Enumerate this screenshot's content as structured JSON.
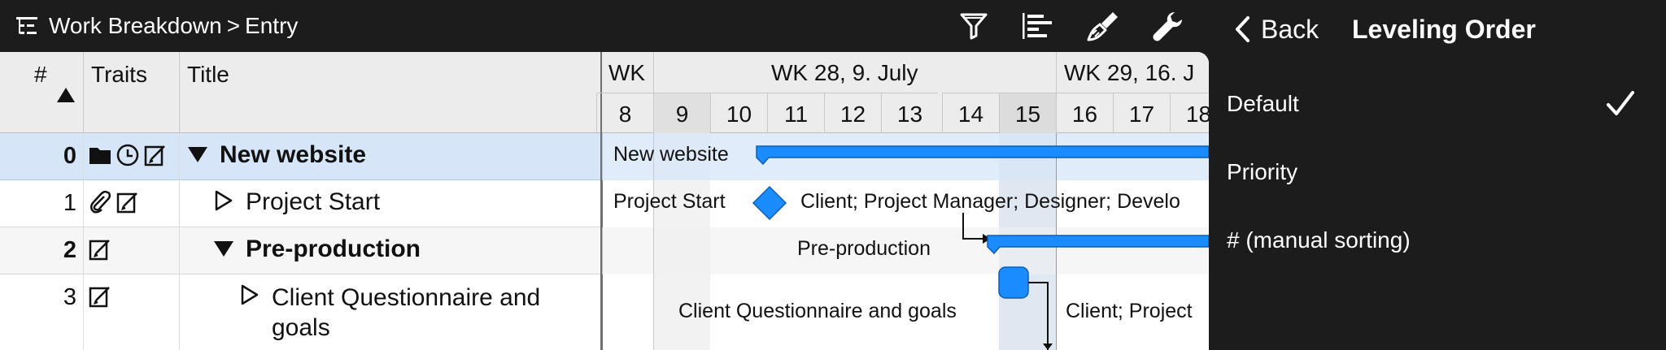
{
  "breadcrumb": {
    "root": "Work Breakdown",
    "separator": ">",
    "current": "Entry"
  },
  "toolbar": {
    "icons": [
      "filter-icon",
      "gantt-layout-icon",
      "style-brush-icon",
      "settings-wrench-icon"
    ]
  },
  "table": {
    "columns": {
      "num": "#",
      "traits": "Traits",
      "title": "Title"
    },
    "rows": [
      {
        "num": "0",
        "title": "New website",
        "traits": [
          "folder-icon",
          "clock-icon",
          "note-icon"
        ],
        "expanded": true,
        "bold": true,
        "selected": true
      },
      {
        "num": "1",
        "title": "Project Start",
        "traits": [
          "attachment-icon",
          "note-icon"
        ],
        "expanded": false,
        "bold": false
      },
      {
        "num": "2",
        "title": "Pre-production",
        "traits": [
          "note-icon"
        ],
        "expanded": true,
        "bold": true
      },
      {
        "num": "3",
        "title_line1": "Client Questionnaire and",
        "title_line2": "goals",
        "traits": [
          "note-icon"
        ],
        "expanded": false,
        "bold": false
      }
    ]
  },
  "gantt": {
    "weeks": [
      "WK",
      "WK 28, 9. July",
      "WK 29, 16. J"
    ],
    "days": [
      "8",
      "9",
      "10",
      "11",
      "12",
      "13",
      "14",
      "15",
      "16",
      "17",
      "18"
    ],
    "labels": {
      "row0": "New website",
      "row1_left": "Project Start",
      "row1_right": "Client; Project Manager; Designer; Develo",
      "row2": "Pre-production",
      "row3_left": "Client Questionnaire and goals",
      "row3_right": "Client; Project"
    },
    "bar_color": "#1a8cff"
  },
  "popover": {
    "back_label": "Back",
    "title": "Leveling Order",
    "options": [
      {
        "label": "Default",
        "selected": true
      },
      {
        "label": "Priority",
        "selected": false
      },
      {
        "label": "# (manual sorting)",
        "selected": false
      }
    ]
  },
  "colors": {
    "accent": "#1a8cff",
    "selected_row": "#d6e6f8",
    "header_bg": "#ececec",
    "chrome": "#1c1c1c"
  }
}
